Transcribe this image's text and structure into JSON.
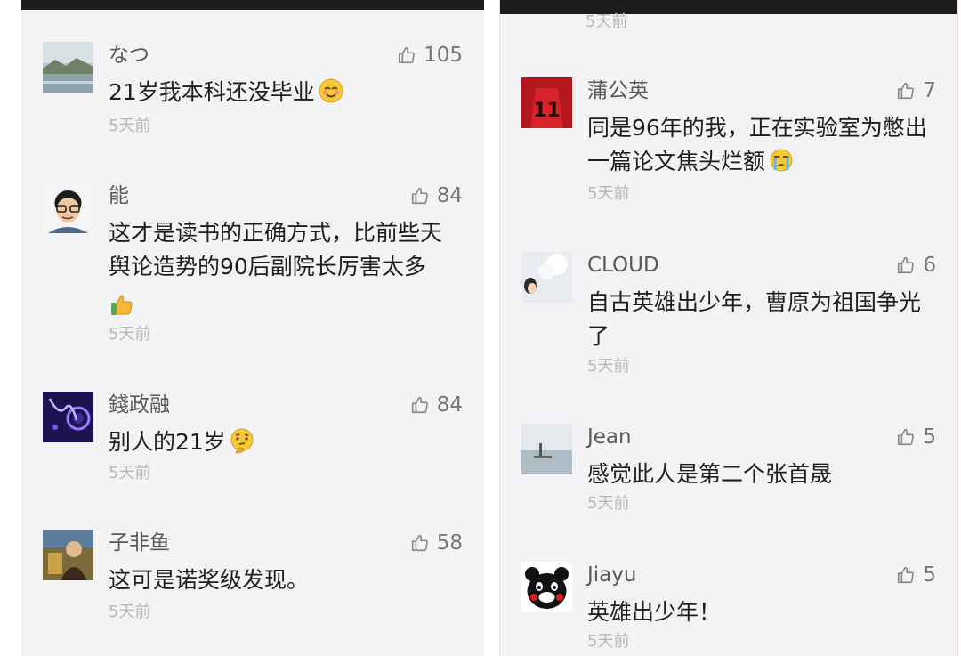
{
  "left_panel": {
    "comments": [
      {
        "name": "なつ",
        "likes": "105",
        "text": "21岁我本科还没毕业",
        "emoji": "smiling-face-icon",
        "time": "5天前"
      },
      {
        "name": "能",
        "likes": "84",
        "line1": "这才是读书的正确方式，比前些天",
        "line2": "舆论造势的90后副院长厉害太多",
        "emoji": "thumbs-up-emoji-icon",
        "time": "5天前"
      },
      {
        "name": "錢政融",
        "likes": "84",
        "text": "别人的21岁",
        "emoji": "thinking-face-icon",
        "time": "5天前"
      },
      {
        "name": "子非鱼",
        "likes": "58",
        "text": "这可是诺奖级发现。",
        "time": "5天前"
      }
    ]
  },
  "right_panel": {
    "top_time": "5天前",
    "comments": [
      {
        "name": "蒲公英",
        "likes": "7",
        "line1": "同是96年的我，正在实验室为憋出",
        "line2": "一篇论文焦头烂额",
        "emoji": "crying-face-icon",
        "time": "5天前"
      },
      {
        "name": "CLOUD",
        "likes": "6",
        "line1": "自古英雄出少年，曹原为祖国争光",
        "line2": "了",
        "time": "5天前"
      },
      {
        "name": "Jean",
        "likes": "5",
        "text": "感觉此人是第二个张首晟",
        "time": "5天前"
      },
      {
        "name": "Jiayu",
        "likes": "5",
        "text": "英雄出少年！",
        "time": "5天前"
      }
    ]
  },
  "colors": {
    "panel_bg": "#f3f3f5",
    "top_bar": "#1b1b1b",
    "name": "#5a5a5a",
    "body_text": "#1e1e1e",
    "timestamp": "#b8b8b8"
  }
}
